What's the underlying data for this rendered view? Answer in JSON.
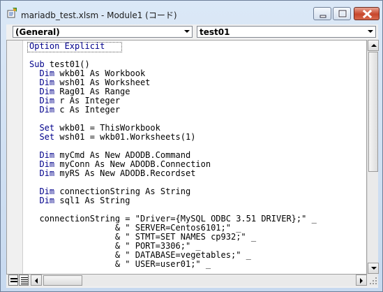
{
  "window": {
    "title": "mariadb_test.xlsm - Module1 (コード)",
    "icons": {
      "app": "vba-module-icon",
      "minimize": "minimize-icon",
      "maximize": "maximize-icon",
      "close": "close-icon"
    }
  },
  "toolbar": {
    "object_combo": "(General)",
    "procedure_combo": "test01"
  },
  "code": {
    "lines": [
      {
        "kw": "Option Explicit",
        "text": ""
      },
      {
        "kw": "",
        "text": ""
      },
      {
        "kw": "Sub",
        "text": " test01()"
      },
      {
        "kw": "  Dim",
        "text": " wkb01 As Workbook"
      },
      {
        "kw": "  Dim",
        "text": " wsh01 As Worksheet"
      },
      {
        "kw": "  Dim",
        "text": " Rag01 As Range"
      },
      {
        "kw": "  Dim",
        "text": " r As Integer"
      },
      {
        "kw": "  Dim",
        "text": " c As Integer"
      },
      {
        "kw": "",
        "text": ""
      },
      {
        "kw": "  Set",
        "text": " wkb01 = ThisWorkbook"
      },
      {
        "kw": "  Set",
        "text": " wsh01 = wkb01.Worksheets(1)"
      },
      {
        "kw": "",
        "text": ""
      },
      {
        "kw": "  Dim",
        "text": " myCmd As New ADODB.Command"
      },
      {
        "kw": "  Dim",
        "text": " myConn As New ADODB.Connection"
      },
      {
        "kw": "  Dim",
        "text": " myRS As New ADODB.Recordset"
      },
      {
        "kw": "",
        "text": ""
      },
      {
        "kw": "  Dim",
        "text": " connectionString As String"
      },
      {
        "kw": "  Dim",
        "text": " sql1 As String"
      },
      {
        "kw": "",
        "text": ""
      },
      {
        "kw": "",
        "text": "  connectionString = \"Driver={MySQL ODBC 3.51 DRIVER};\" _"
      },
      {
        "kw": "",
        "text": "                 & \" SERVER=Centos6101;\" _"
      },
      {
        "kw": "",
        "text": "                 & \" STMT=SET NAMES cp932;\" _"
      },
      {
        "kw": "",
        "text": "                 & \" PORT=3306;\" _"
      },
      {
        "kw": "",
        "text": "                 & \" DATABASE=vegetables;\" _"
      },
      {
        "kw": "",
        "text": "                 & \" USER=user01;\" _"
      }
    ]
  },
  "colors": {
    "keyword": "#00008b",
    "text": "#000000",
    "title_bar": "#c7d9ef",
    "close_button": "#c8462b"
  }
}
